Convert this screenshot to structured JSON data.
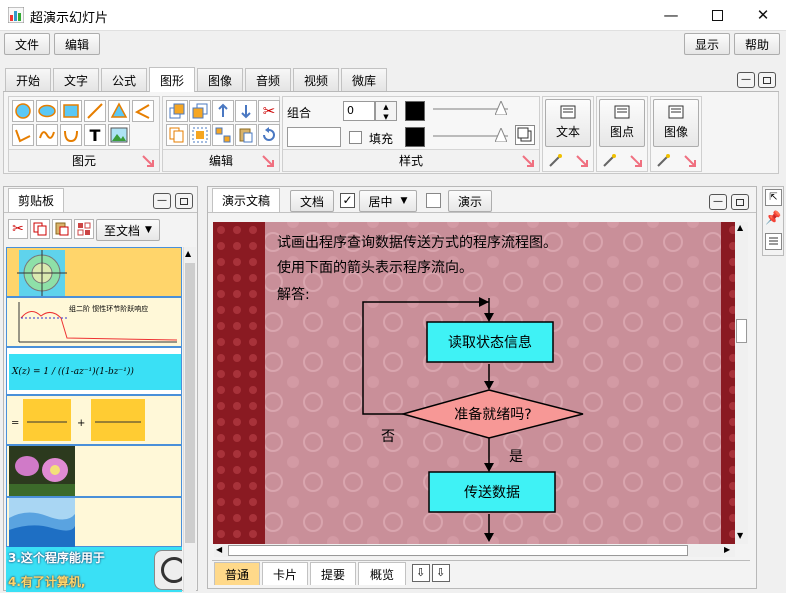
{
  "window": {
    "title": "超演示幻灯片"
  },
  "menu": {
    "file": "文件",
    "edit": "编辑",
    "display": "显示",
    "help": "帮助"
  },
  "tabs": [
    "开始",
    "文字",
    "公式",
    "图形",
    "图像",
    "音频",
    "视频",
    "微库"
  ],
  "ribbon": {
    "group_shapes": "图元",
    "group_edit": "编辑",
    "group_style": "样式",
    "combine_label": "组合",
    "spin_value": "0",
    "fill_label": "填充",
    "btn_text": "文本",
    "btn_points": "图点",
    "btn_image": "图像"
  },
  "clipboard": {
    "tab": "剪贴板",
    "to_doc": "至文档"
  },
  "clip_items": {
    "chart_caption": "组二阶 惯性环节阶跃响应",
    "formula1": "X(z) = 1 / ((1-az⁻¹)(1-bz⁻¹))",
    "tiny_text_1": "3.这个程序能用于",
    "tiny_text_2": "4.有了计算机,"
  },
  "doc_tabs": {
    "draft": "演示文稿",
    "doc": "文档",
    "align": "居中",
    "present": "演示"
  },
  "slide": {
    "line1": "试画出程序查询数据传送方式的程序流程图。",
    "line2": "使用下面的箭头表示程序流向。",
    "line3": "解答:",
    "box1": "读取状态信息",
    "decision": "准备就绪吗?",
    "no": "否",
    "yes": "是",
    "box2": "传送数据"
  },
  "view_tabs": [
    "普通",
    "卡片",
    "提要",
    "概览"
  ],
  "colors": {
    "accent_cyan": "#3ff2f5",
    "decision_pink": "#f79896",
    "slide_bg": "#c98f99",
    "clip_yellow": "#ffd56b",
    "clip_cyan": "#3ae0f5"
  }
}
